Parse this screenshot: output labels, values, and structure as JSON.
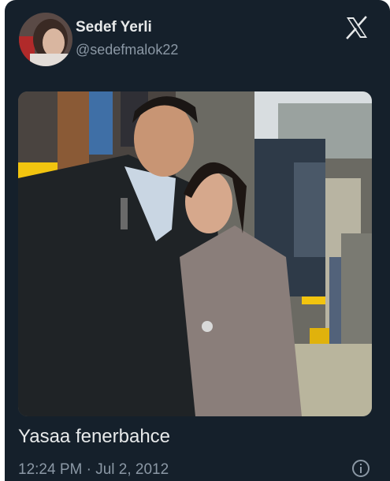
{
  "author": {
    "name": "Sedef Yerli",
    "handle": "@sedefmalok22"
  },
  "tweet": {
    "text": "Yasaa fenerbahce",
    "time": "12:24 PM",
    "separator": "·",
    "date": "Jul 2, 2012"
  },
  "icons": {
    "logo": "x-logo-icon",
    "info": "info-icon"
  },
  "colors": {
    "background": "#15202b",
    "primary_text": "#e7e9ea",
    "secondary_text": "#8b98a5",
    "stadium_yellow": "#f2c40f"
  }
}
